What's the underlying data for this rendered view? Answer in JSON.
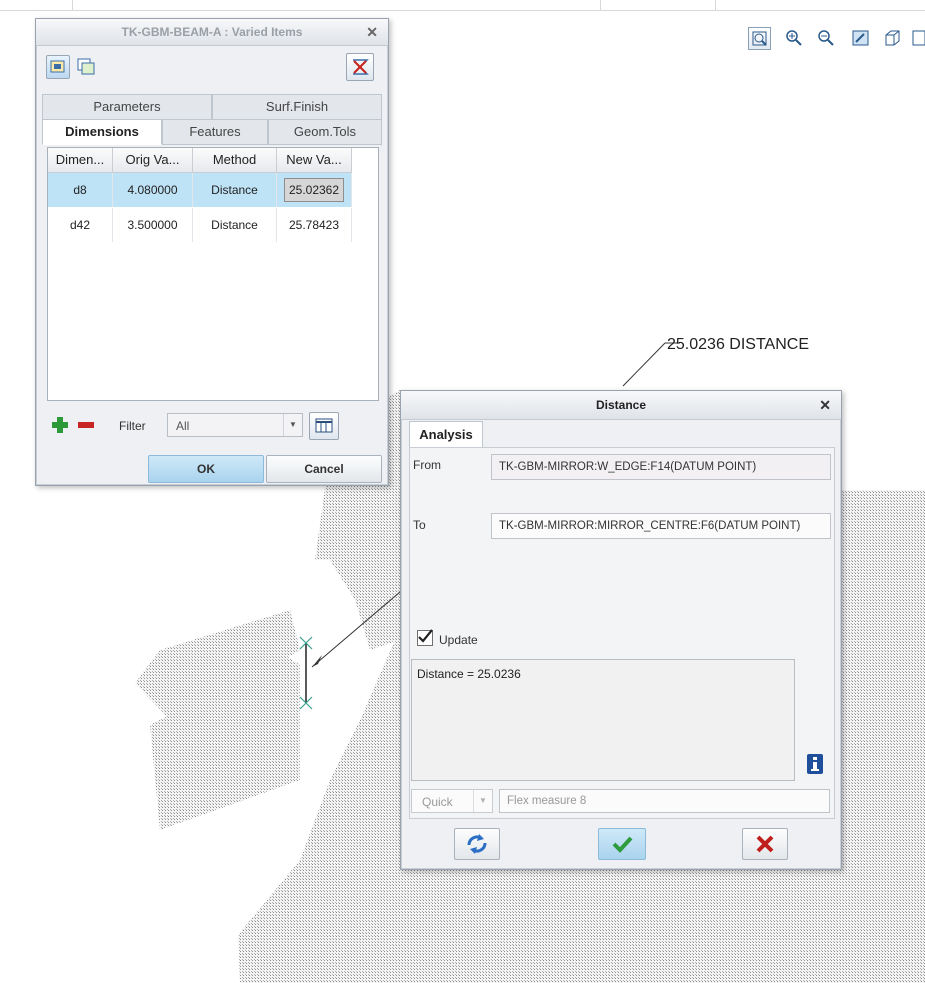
{
  "graphics_toolbar": {
    "buttons": [
      "zoom-refit-icon",
      "zoom-in-icon",
      "zoom-out-icon",
      "repaint-icon",
      "view-orientation-icon",
      "saved-views-icon"
    ]
  },
  "varied_items": {
    "title": "TK-GBM-BEAM-A : Varied Items",
    "tabs_top": [
      "Parameters",
      "Surf.Finish"
    ],
    "tabs_bottom": [
      "Dimensions",
      "Features",
      "Geom.Tols"
    ],
    "active_tab": "Dimensions",
    "columns": [
      "Dimen...",
      "Orig Va...",
      "Method",
      "New Va..."
    ],
    "rows": [
      {
        "dim": "d8",
        "orig": "4.080000",
        "method": "Distance",
        "new": "25.02362",
        "selected": true
      },
      {
        "dim": "d42",
        "orig": "3.500000",
        "method": "Distance",
        "new": "25.78423",
        "selected": false
      }
    ],
    "filter_label": "Filter",
    "filter_value": "All",
    "ok_label": "OK",
    "cancel_label": "Cancel"
  },
  "annotation": {
    "text": "25.0236 DISTANCE"
  },
  "distance_dialog": {
    "title": "Distance",
    "tab": "Analysis",
    "from_label": "From",
    "from_value": "TK-GBM-MIRROR:W_EDGE:F14(DATUM POINT)",
    "to_label": "To",
    "to_value": "TK-GBM-MIRROR:MIRROR_CENTRE:F6(DATUM POINT)",
    "update_label": "Update",
    "update_checked": true,
    "result_text": "Distance = 25.0236",
    "quick_label": "Quick",
    "name_value": "Flex measure 8"
  },
  "colors": {
    "selected_row": "#bfe3f6",
    "ok_button": "#b7dcf2",
    "confirm_green": "#2e9b3c",
    "cancel_red": "#c0201c",
    "add_green": "#2d9a3a",
    "remove_red": "#c82424"
  }
}
